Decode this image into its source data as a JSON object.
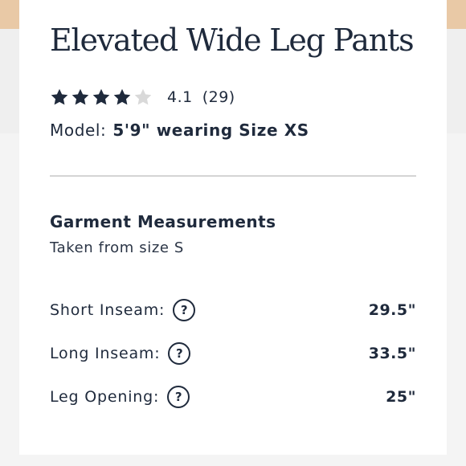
{
  "product": {
    "title": "Elevated Wide Leg Pants",
    "rating": {
      "value": "4.1",
      "count": "(29)",
      "stars": 4.1,
      "max_stars": 5
    },
    "model": {
      "label": "Model:",
      "value": "5'9\" wearing Size XS"
    }
  },
  "measurements": {
    "heading": "Garment Measurements",
    "subheading": "Taken from size S",
    "help_icon_glyph": "?",
    "rows": [
      {
        "label": "Short Inseam:",
        "value": "29.5\""
      },
      {
        "label": "Long Inseam:",
        "value": "33.5\""
      },
      {
        "label": "Leg Opening:",
        "value": "25\""
      }
    ]
  },
  "colors": {
    "text": "#1f2a3c",
    "star_filled": "#1f2a3c",
    "star_empty": "#d9d9d9",
    "divider": "#d4d4d4"
  }
}
